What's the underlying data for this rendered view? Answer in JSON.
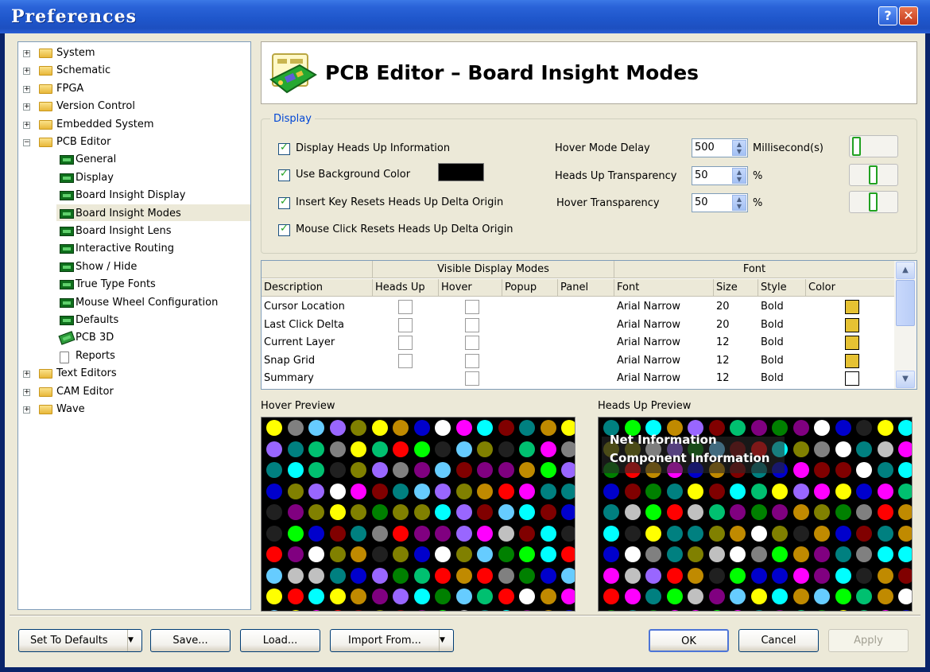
{
  "window": {
    "title": "Preferences"
  },
  "tree": {
    "items": [
      {
        "label": "System",
        "level": 0,
        "icon": "folder",
        "expander": "+"
      },
      {
        "label": "Schematic",
        "level": 0,
        "icon": "folder",
        "expander": "+"
      },
      {
        "label": "FPGA",
        "level": 0,
        "icon": "folder",
        "expander": "+"
      },
      {
        "label": "Version Control",
        "level": 0,
        "icon": "folder",
        "expander": "+"
      },
      {
        "label": "Embedded System",
        "level": 0,
        "icon": "folder",
        "expander": "+"
      },
      {
        "label": "PCB Editor",
        "level": 0,
        "icon": "folder-open",
        "expander": "−"
      },
      {
        "label": "General",
        "level": 1,
        "icon": "chip"
      },
      {
        "label": "Display",
        "level": 1,
        "icon": "chip"
      },
      {
        "label": "Board Insight Display",
        "level": 1,
        "icon": "chip"
      },
      {
        "label": "Board Insight Modes",
        "level": 1,
        "icon": "chip",
        "selected": true
      },
      {
        "label": "Board Insight Lens",
        "level": 1,
        "icon": "chip"
      },
      {
        "label": "Interactive Routing",
        "level": 1,
        "icon": "chip"
      },
      {
        "label": "Show / Hide",
        "level": 1,
        "icon": "chip"
      },
      {
        "label": "True Type Fonts",
        "level": 1,
        "icon": "chip"
      },
      {
        "label": "Mouse Wheel Configuration",
        "level": 1,
        "icon": "chip"
      },
      {
        "label": "Defaults",
        "level": 1,
        "icon": "chip"
      },
      {
        "label": "PCB 3D",
        "level": 1,
        "icon": "pcb3d"
      },
      {
        "label": "Reports",
        "level": 1,
        "icon": "report"
      },
      {
        "label": "Text Editors",
        "level": 0,
        "icon": "folder",
        "expander": "+"
      },
      {
        "label": "CAM Editor",
        "level": 0,
        "icon": "folder",
        "expander": "+"
      },
      {
        "label": "Wave",
        "level": 0,
        "icon": "folder",
        "expander": "+"
      }
    ]
  },
  "header": {
    "title": "PCB Editor – Board Insight Modes",
    "icon": "pcb-board-icon"
  },
  "display": {
    "group_title": "Display",
    "checkboxes": [
      {
        "label": "Display Heads Up Information",
        "checked": true
      },
      {
        "label": "Use Background Color",
        "checked": true
      },
      {
        "label": "Insert Key Resets Heads Up Delta Origin",
        "checked": true
      },
      {
        "label": "Mouse Click Resets Heads Up Delta Origin",
        "checked": true
      }
    ],
    "background_color": "#000000",
    "hover_delay": {
      "label": "Hover Mode Delay",
      "value": "500",
      "unit": "Millisecond(s)",
      "level": 0
    },
    "heads_up_transparency": {
      "label": "Heads Up Transparency",
      "value": "50",
      "unit": "%",
      "level": 0.5
    },
    "hover_transparency": {
      "label": "Hover Transparency",
      "value": "50",
      "unit": "%",
      "level": 0.5
    }
  },
  "table": {
    "group_headers": {
      "visible": "Visible Display Modes",
      "font": "Font"
    },
    "columns": [
      "Description",
      "Heads Up",
      "Hover",
      "Popup",
      "Panel",
      "Font",
      "Size",
      "Style",
      "Color"
    ],
    "rows": [
      {
        "description": "Cursor Location",
        "heads_up": false,
        "hover": false,
        "font": "Arial Narrow",
        "size": "20",
        "style": "Bold",
        "color": "#e6c233"
      },
      {
        "description": "Last Click Delta",
        "heads_up": false,
        "hover": false,
        "font": "Arial Narrow",
        "size": "20",
        "style": "Bold",
        "color": "#e6c233"
      },
      {
        "description": "Current Layer",
        "heads_up": false,
        "hover": false,
        "font": "Arial Narrow",
        "size": "12",
        "style": "Bold",
        "color": "#e6c233"
      },
      {
        "description": "Snap Grid",
        "heads_up": false,
        "hover": false,
        "font": "Arial Narrow",
        "size": "12",
        "style": "Bold",
        "color": "#e6c233"
      },
      {
        "description": "Summary",
        "heads_up": null,
        "hover": false,
        "font": "Arial Narrow",
        "size": "12",
        "style": "Bold",
        "color": "#ffffff"
      }
    ]
  },
  "previews": {
    "hover_label": "Hover Preview",
    "heads_up_label": "Heads Up Preview",
    "heads_up_lines": [
      "Net Information",
      "Component Information"
    ]
  },
  "buttons": {
    "set_to_defaults": "Set To Defaults",
    "save": "Save...",
    "load": "Load...",
    "import_from": "Import From...",
    "ok": "OK",
    "cancel": "Cancel",
    "apply": "Apply"
  }
}
